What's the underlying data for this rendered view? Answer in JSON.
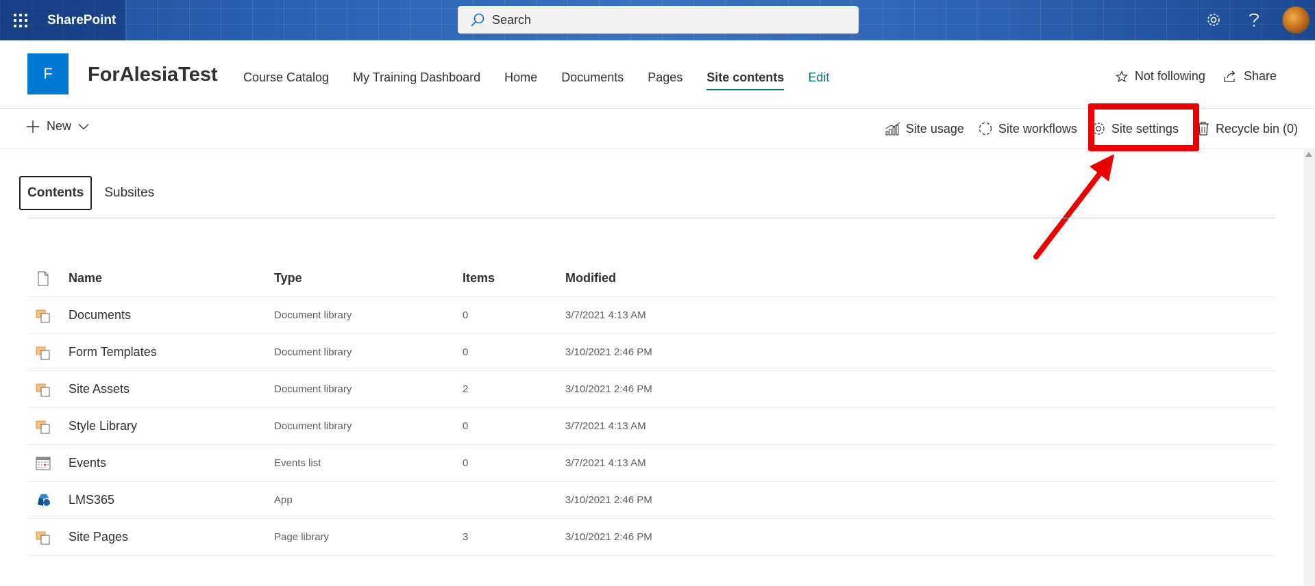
{
  "suite": {
    "app_name": "SharePoint",
    "search_placeholder": "Search",
    "settings_icon": "gear-icon",
    "help_icon": "question-icon"
  },
  "site": {
    "logo_letter": "F",
    "title": "ForAlesiaTest",
    "nav": [
      "Course Catalog",
      "My Training Dashboard",
      "Home",
      "Documents",
      "Pages",
      "Site contents",
      "Edit"
    ],
    "active_nav": "Site contents",
    "follow_label": "Not following",
    "share_label": "Share"
  },
  "command_bar": {
    "new_label": "New",
    "site_usage": "Site usage",
    "site_workflows": "Site workflows",
    "site_settings": "Site settings",
    "recycle_bin": "Recycle bin (0)"
  },
  "tabs": {
    "contents": "Contents",
    "subsites": "Subsites"
  },
  "list": {
    "headers": {
      "name": "Name",
      "type": "Type",
      "items": "Items",
      "modified": "Modified"
    },
    "rows": [
      {
        "name": "Documents",
        "type": "Document library",
        "items": "0",
        "modified": "3/7/2021 4:13 AM",
        "icon": "library-icon"
      },
      {
        "name": "Form Templates",
        "type": "Document library",
        "items": "0",
        "modified": "3/10/2021 2:46 PM",
        "icon": "library-icon"
      },
      {
        "name": "Site Assets",
        "type": "Document library",
        "items": "2",
        "modified": "3/10/2021 2:46 PM",
        "icon": "library-icon"
      },
      {
        "name": "Style Library",
        "type": "Document library",
        "items": "0",
        "modified": "3/7/2021 4:13 AM",
        "icon": "library-icon"
      },
      {
        "name": "Events",
        "type": "Events list",
        "items": "0",
        "modified": "3/7/2021 4:13 AM",
        "icon": "calendar-icon"
      },
      {
        "name": "LMS365",
        "type": "App",
        "items": "",
        "modified": "3/10/2021 2:46 PM",
        "icon": "app-icon"
      },
      {
        "name": "Site Pages",
        "type": "Page library",
        "items": "3",
        "modified": "3/10/2021 2:46 PM",
        "icon": "library-icon"
      }
    ]
  },
  "colors": {
    "accent": "#03787c",
    "site_logo": "#0078d4",
    "annotation": "#ee0000"
  }
}
